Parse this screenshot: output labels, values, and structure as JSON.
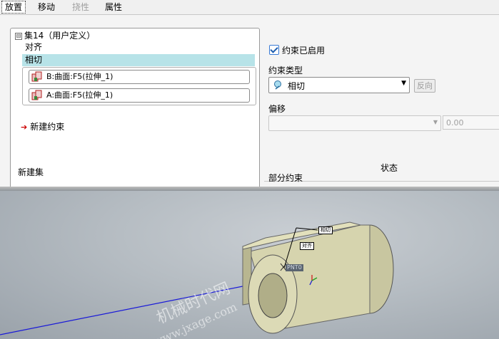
{
  "tabs": [
    "放置",
    "移动",
    "挠性",
    "属性"
  ],
  "tree": {
    "root_label": "集14（用户定义）",
    "expander": "⊟",
    "children": [
      "对齐",
      "相切"
    ],
    "refs": [
      "B:曲面:F5(拉伸_1)",
      "A:曲面:F5(拉伸_1)"
    ],
    "new_constraint": "新建约束",
    "new_set": "新建集"
  },
  "constraint": {
    "enabled_label": "约束已启用",
    "enabled": true,
    "type_label": "约束类型",
    "type_value": "相切",
    "flip_label": "反向",
    "offset_label": "偏移",
    "offset_value": "0.00"
  },
  "status": {
    "header": "状态",
    "text": "部分约束"
  },
  "viewport": {
    "tag_top": "相切",
    "tag_mid": "对齐",
    "point_label": "PNT0",
    "watermark_cn": "机械时代网",
    "watermark_url": "www.jxage.com"
  }
}
